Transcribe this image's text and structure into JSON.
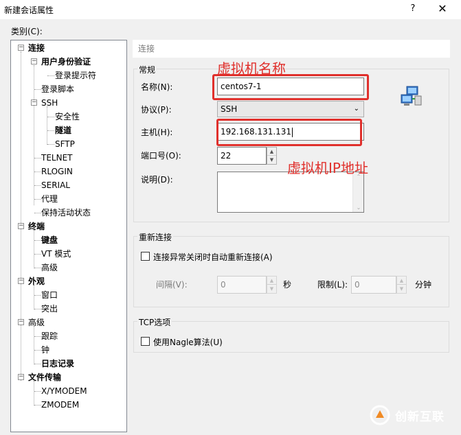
{
  "window": {
    "title": "新建会话属性",
    "help_label": "?",
    "close_label": "✕"
  },
  "category_label": "类别(C):",
  "tree": {
    "items": [
      {
        "label": "连接",
        "bold": true
      },
      {
        "label": "用户身份验证",
        "bold": true
      },
      {
        "label": "登录提示符",
        "bold": false
      },
      {
        "label": "登录脚本",
        "bold": false
      },
      {
        "label": "SSH",
        "bold": false
      },
      {
        "label": "安全性",
        "bold": false
      },
      {
        "label": "隧道",
        "bold": true
      },
      {
        "label": "SFTP",
        "bold": false
      },
      {
        "label": "TELNET",
        "bold": false
      },
      {
        "label": "RLOGIN",
        "bold": false
      },
      {
        "label": "SERIAL",
        "bold": false
      },
      {
        "label": "代理",
        "bold": false
      },
      {
        "label": "保持活动状态",
        "bold": false
      },
      {
        "label": "终端",
        "bold": true
      },
      {
        "label": "键盘",
        "bold": true
      },
      {
        "label": "VT 模式",
        "bold": false
      },
      {
        "label": "高级",
        "bold": false
      },
      {
        "label": "外观",
        "bold": true
      },
      {
        "label": "窗口",
        "bold": false
      },
      {
        "label": "突出",
        "bold": false
      },
      {
        "label": "高级",
        "bold": false
      },
      {
        "label": "跟踪",
        "bold": false
      },
      {
        "label": "钟",
        "bold": false
      },
      {
        "label": "日志记录",
        "bold": true
      },
      {
        "label": "文件传输",
        "bold": true
      },
      {
        "label": "X/YMODEM",
        "bold": false
      },
      {
        "label": "ZMODEM",
        "bold": false
      }
    ]
  },
  "panel_header": "连接",
  "general": {
    "title": "常规",
    "name_label": "名称(N):",
    "name_value": "centos7-1",
    "protocol_label": "协议(P):",
    "protocol_value": "SSH",
    "host_label": "主机(H):",
    "host_value": "192.168.131.131",
    "port_label": "端口号(O):",
    "port_value": "22",
    "desc_label": "说明(D):",
    "desc_value": ""
  },
  "reconnect": {
    "title": "重新连接",
    "checkbox_label": "连接异常关闭时自动重新连接(A)",
    "checked": false,
    "interval_label": "间隔(V):",
    "interval_value": "0",
    "interval_unit": "秒",
    "limit_label": "限制(L):",
    "limit_value": "0",
    "limit_unit": "分钟"
  },
  "tcp": {
    "title": "TCP选项",
    "nagle_label": "使用Nagle算法(U)",
    "checked": false
  },
  "annotations": {
    "vm_name": "虚拟机名称",
    "vm_ip": "虚拟机IP地址",
    "color": "#e0302c"
  },
  "watermark": {
    "text": "创新互联"
  },
  "icons": {
    "network": "network-computers-icon",
    "expander_collapse": "minus-icon",
    "dropdown": "chevron-down-icon"
  }
}
